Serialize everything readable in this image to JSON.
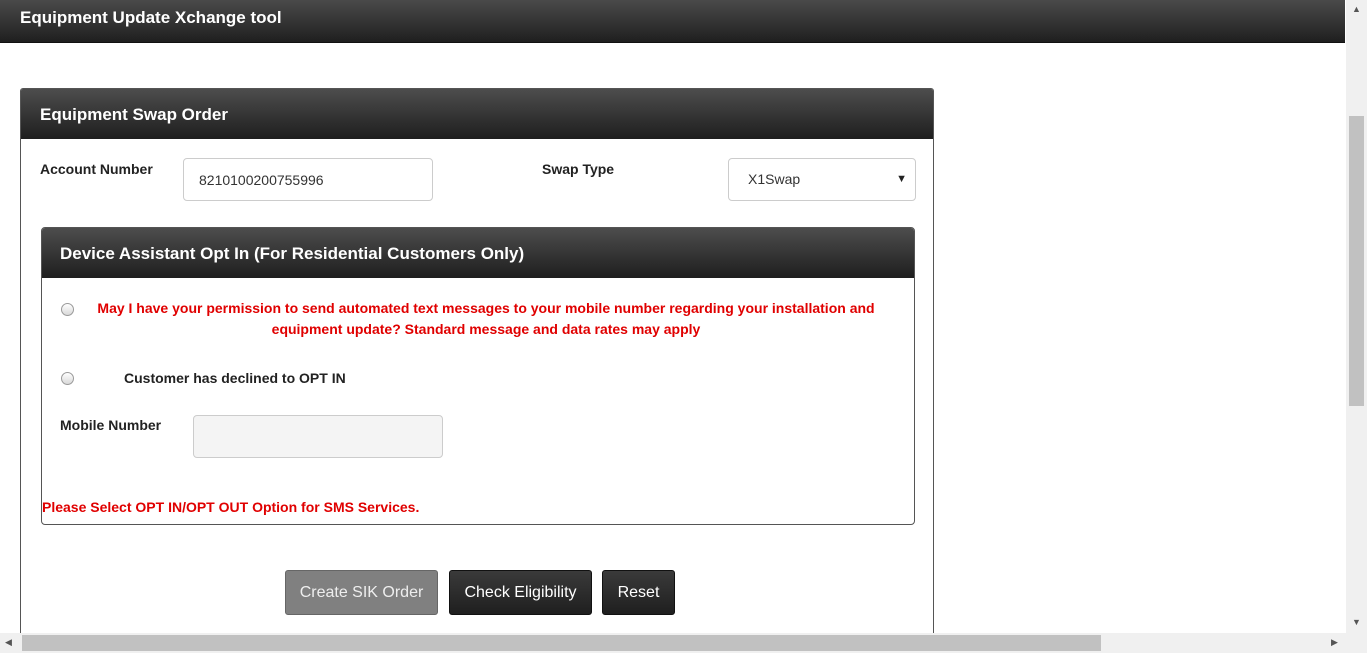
{
  "app": {
    "title": "Equipment Update Xchange tool"
  },
  "swap_order": {
    "title": "Equipment Swap Order",
    "account_label": "Account Number",
    "account_value": "8210100200755996",
    "swap_type_label": "Swap Type",
    "swap_type_value": "X1Swap"
  },
  "opt_in": {
    "title": "Device Assistant Opt In (For Residential Customers Only)",
    "permission_text": "May I have your permission to send automated text messages to your mobile number regarding your installation and equipment update? Standard message and data rates may apply",
    "decline_text": "Customer has declined to OPT IN",
    "mobile_label": "Mobile Number",
    "mobile_value": "",
    "error_text": "Please Select OPT IN/OPT OUT Option for SMS Services."
  },
  "buttons": {
    "create": "Create SIK Order",
    "check": "Check Eligibility",
    "reset": "Reset"
  },
  "icons": {
    "select_arrow": "▼",
    "scroll_up": "▲",
    "scroll_down": "▼",
    "scroll_left": "◀",
    "scroll_right": "▶"
  },
  "colors": {
    "error": "#e00000",
    "header": "#2a2a2a"
  }
}
